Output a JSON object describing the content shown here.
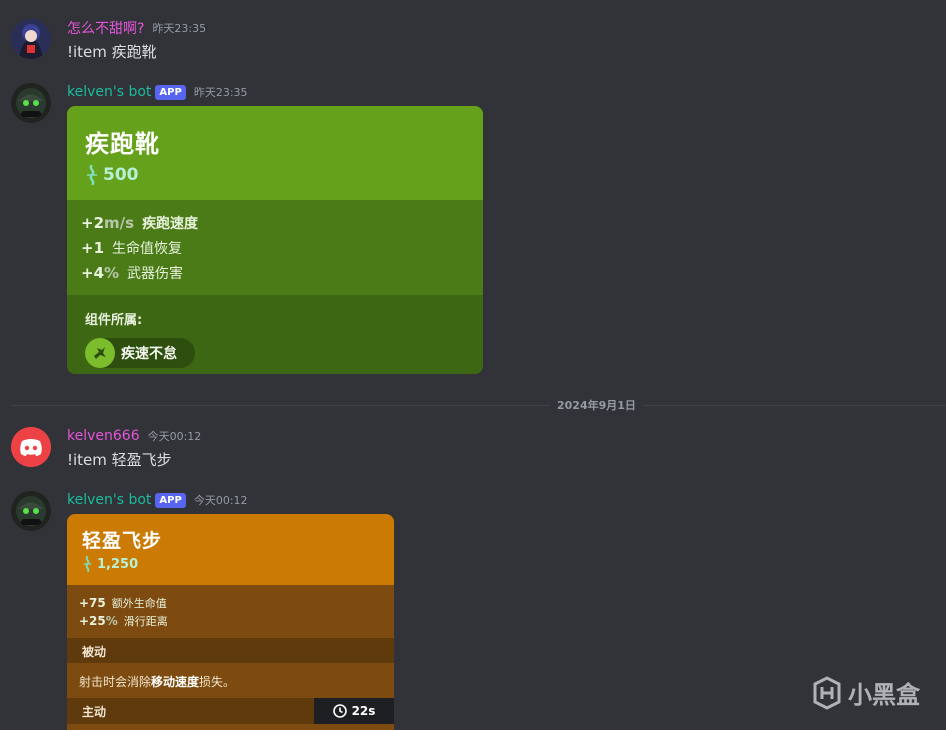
{
  "messages": [
    {
      "username": "怎么不甜啊?",
      "timestamp": "昨天23:35",
      "content": "!item 疾跑靴"
    },
    {
      "username": "kelven's bot",
      "badge": "APP",
      "timestamp": "昨天23:35",
      "embed": {
        "title": "疾跑靴",
        "price": "500",
        "stats": [
          {
            "value": "+2",
            "unit": "m/s",
            "name": "疾跑速度"
          },
          {
            "value": "+1",
            "unit": "",
            "name": "生命值恢复"
          },
          {
            "value": "+4",
            "unit": "%",
            "name": "武器伤害"
          }
        ],
        "component_label": "组件所属:",
        "component_name": "疾速不怠",
        "color": "#65a11a"
      }
    },
    {
      "username": "kelven666",
      "timestamp": "今天00:12",
      "content": "!item 轻盈飞步"
    },
    {
      "username": "kelven's bot",
      "badge": "APP",
      "timestamp": "今天00:12",
      "embed": {
        "title": "轻盈飞步",
        "price": "1,250",
        "stats": [
          {
            "value": "+75",
            "unit": "",
            "name": "额外生命值"
          },
          {
            "value": "+25",
            "unit": "%",
            "name": "滑行距离"
          }
        ],
        "passive_label": "被动",
        "passive_desc_pre": "射击时会消除",
        "passive_desc_bold": "移动速度",
        "passive_desc_post": "损失。",
        "active_label": "主动",
        "cooldown": "22s",
        "color": "#cb7a03"
      }
    }
  ],
  "date_divider": "2024年9月1日",
  "watermark": "小黑盒"
}
